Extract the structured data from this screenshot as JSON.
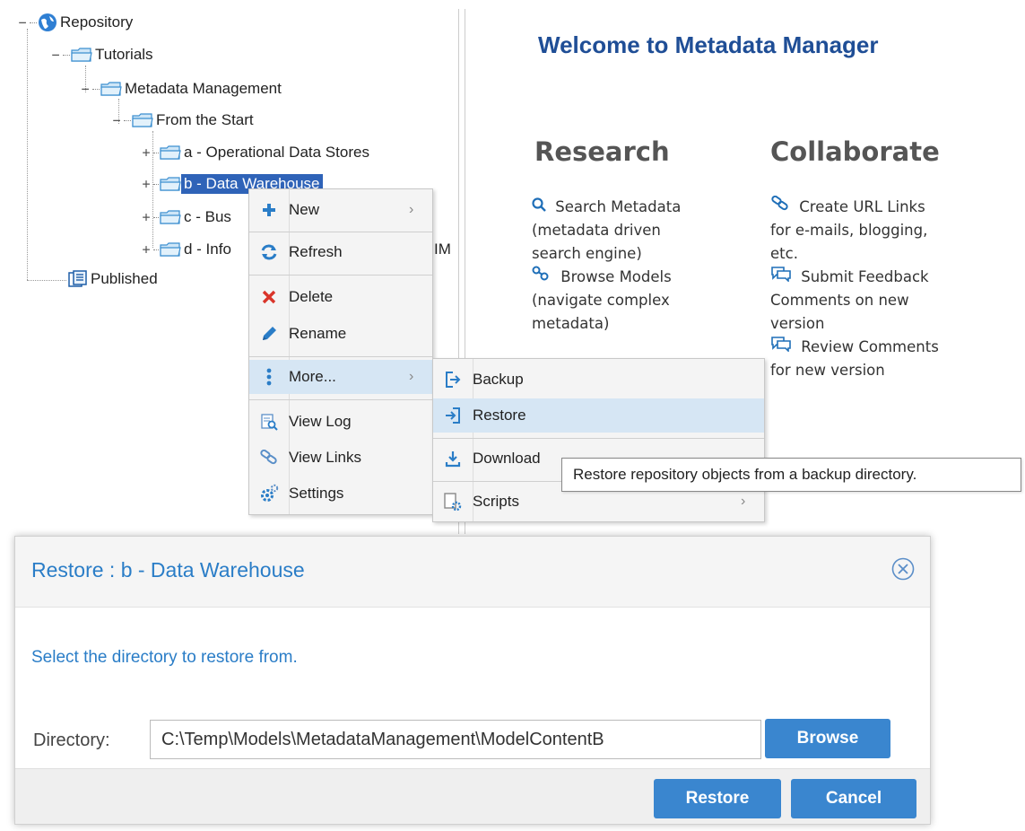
{
  "tree": {
    "repository": "Repository",
    "tutorials": "Tutorials",
    "metadata_management": "Metadata Management",
    "from_the_start": "From the Start",
    "children": [
      "a - Operational Data Stores",
      "b - Data Warehouse",
      "c - Bus",
      "d - Info"
    ],
    "partial_text": "IM",
    "published": "Published"
  },
  "welcome": {
    "title": "Welcome to Metadata Manager",
    "research_heading": "Research",
    "collaborate_heading": "Collaborate",
    "research": {
      "search_link": "Search Metadata",
      "search_desc1": "(metadata driven",
      "search_desc2": "search engine)",
      "browse_link": "Browse Models",
      "browse_desc1": "(navigate complex",
      "browse_desc2": "metadata)"
    },
    "collaborate": {
      "url_link": "Create URL Links",
      "url_desc1": "for e-mails, blogging,",
      "url_desc2": "etc.",
      "feedback_link": "Submit Feedback",
      "feedback_desc1": "Comments on new",
      "feedback_desc2": "version",
      "review_link": "Review Comments",
      "review_desc1": "for new version"
    }
  },
  "context_menu": {
    "new": "New",
    "refresh": "Refresh",
    "delete": "Delete",
    "rename": "Rename",
    "more": "More...",
    "view_log": "View Log",
    "view_links": "View Links",
    "settings": "Settings"
  },
  "submenu": {
    "backup": "Backup",
    "restore": "Restore",
    "download": "Download",
    "scripts": "Scripts"
  },
  "tooltip": "Restore repository objects from a backup directory.",
  "dialog": {
    "title": "Restore : b - Data Warehouse",
    "message": "Select the directory to restore from.",
    "directory_label": "Directory:",
    "directory_value": "C:\\Temp\\Models\\MetadataManagement\\ModelContentB",
    "browse": "Browse",
    "restore": "Restore",
    "cancel": "Cancel"
  },
  "colors": {
    "accent": "#2a7dc7",
    "title_blue": "#1f4e96",
    "selection": "#2f63b8",
    "button": "#3a86cf",
    "delete_red": "#d9352a"
  }
}
